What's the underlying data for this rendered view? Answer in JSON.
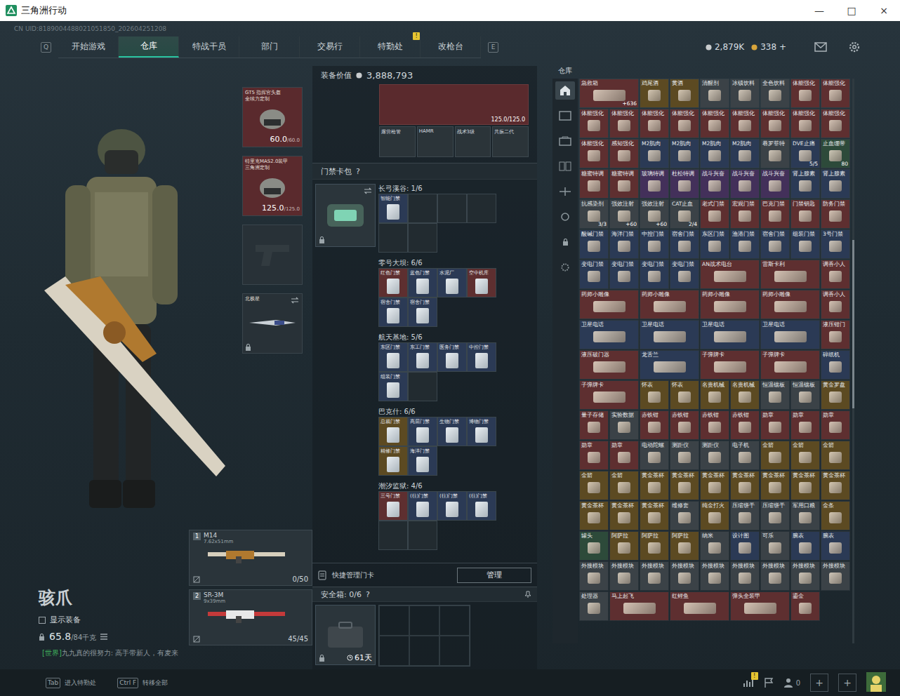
{
  "window": {
    "title": "三角洲行动",
    "controls": [
      "—",
      "□",
      "×"
    ]
  },
  "uid": "CN UID:8189004488021051850_202604251208",
  "nav": {
    "left_key": "Q",
    "right_key": "E",
    "tabs": [
      {
        "label": "开始游戏",
        "selected": false
      },
      {
        "label": "仓库",
        "selected": true
      },
      {
        "label": "特战干员",
        "selected": false
      },
      {
        "label": "部门",
        "selected": false
      },
      {
        "label": "交易行",
        "selected": false
      },
      {
        "label": "特勤处",
        "selected": false,
        "badge": "!"
      },
      {
        "label": "改枪台",
        "selected": false
      }
    ],
    "currency": [
      {
        "value": "2,879K",
        "color": "#c9ccce"
      },
      {
        "value": "338 +",
        "color": "#d9a53b"
      }
    ]
  },
  "equipment": [
    {
      "kind": "gear",
      "name": "GT5 指挥官头盔",
      "subtitle": "全续力定制",
      "durability": "60.0",
      "max": "/60.0"
    },
    {
      "kind": "gear",
      "name": "特里克MAS2.0装甲",
      "subtitle": "三角洲定制",
      "durability": "125.0",
      "max": "/125.0"
    },
    {
      "kind": "empty"
    },
    {
      "kind": "melee",
      "name": "北极星"
    }
  ],
  "character": {
    "name": "骇爪",
    "show_equipment": {
      "label": "显示装备",
      "checked": false
    },
    "weight": {
      "current": "65.8",
      "max": "/84千克"
    }
  },
  "weapons": [
    {
      "slot": "1",
      "name": "M14",
      "ammo_type": "7.62x51mm",
      "ammo": "0/50"
    },
    {
      "slot": "2",
      "name": "SR-3M",
      "ammo_type": "9x39mm",
      "ammo": "45/45"
    }
  ],
  "chat": {
    "channel": "[世界]",
    "user": "九九真的很努力",
    "message": ": 高手带新人，有麦来"
  },
  "hints": [
    {
      "key": "Tab",
      "label": "进入特勤处"
    },
    {
      "key": "Ctrl F",
      "label": "转移全部"
    }
  ],
  "loadout": {
    "label": "装备价值",
    "value": "3,888,793",
    "rig_durability": "125.0/125.0",
    "items": [
      "露营枪管",
      "HAMR",
      "战术3级",
      "共振二代"
    ]
  },
  "keycards": {
    "title": "门禁卡包",
    "help": "?",
    "maps": [
      {
        "name": "长弓溪谷: 1/6",
        "cards": [
          {
            "name": "智能门禁",
            "color": "#2b3a55"
          }
        ]
      },
      {
        "name": "零号大坝: 6/6",
        "cards": [
          {
            "name": "红色门禁",
            "color": "#5e2f30"
          },
          {
            "name": "蓝色门禁",
            "color": "#2b3a55"
          },
          {
            "name": "水泥厂",
            "color": "#2b3a55"
          },
          {
            "name": "空中机库",
            "color": "#5e2f30"
          },
          {
            "name": "宿舍门禁",
            "color": "#2b3a55"
          },
          {
            "name": "宿舍门禁",
            "color": "#2b3a55"
          }
        ]
      },
      {
        "name": "航天基地: 5/6",
        "cards": [
          {
            "name": "东区门禁",
            "color": "#2b3a55"
          },
          {
            "name": "东工门禁",
            "color": "#2b3a55"
          },
          {
            "name": "医务门禁",
            "color": "#2b3a55"
          },
          {
            "name": "中控门禁",
            "color": "#2b3a55"
          },
          {
            "name": "组装门禁",
            "color": "#2b3a55"
          }
        ]
      },
      {
        "name": "巴克什: 6/6",
        "cards": [
          {
            "name": "总裁门禁",
            "color": "#5c4a22"
          },
          {
            "name": "高层门禁",
            "color": "#2b3a55"
          },
          {
            "name": "生物门禁",
            "color": "#2b3a55"
          },
          {
            "name": "博物门禁",
            "color": "#2b3a55"
          },
          {
            "name": "精修门禁",
            "color": "#5c4a22"
          },
          {
            "name": "海洋门禁",
            "color": "#2b3a55"
          }
        ]
      },
      {
        "name": "潮汐监狱: 4/6",
        "cards": [
          {
            "name": "三号门禁",
            "color": "#5e2f30"
          },
          {
            "name": "(往)门禁",
            "color": "#2b3a55"
          },
          {
            "name": "(往)门禁",
            "color": "#2b3a55"
          },
          {
            "name": "(往)门禁",
            "color": "#2b3a55"
          }
        ]
      }
    ]
  },
  "quick_manage": {
    "label": "快捷管理门卡",
    "button": "管理"
  },
  "safe": {
    "title": "安全箱: 0/6",
    "help": "?",
    "time": "61天"
  },
  "stash": {
    "title": "仓库",
    "rail": [
      {
        "selected": true
      },
      {
        "selected": false
      },
      {
        "selected": false
      },
      {
        "selected": false
      },
      {
        "selected": false
      },
      {
        "selected": false
      },
      {
        "selected": false
      },
      {
        "selected": false
      }
    ],
    "items": [
      {
        "name": "急救箱",
        "color": "#5e2f30",
        "count": "+636",
        "kind": "wide"
      },
      {
        "name": "鸡尾酒",
        "color": "#5c4a22",
        "kind": "single"
      },
      {
        "name": "黄酒",
        "color": "#5c4a22",
        "kind": "single"
      },
      {
        "name": "清醒剂",
        "color": "#3b4247",
        "kind": "single"
      },
      {
        "name": "冰镇饮料",
        "color": "#3b4247",
        "kind": "single"
      },
      {
        "name": "全色饮料",
        "color": "#3b4247",
        "kind": "single"
      },
      {
        "name": "体能强化",
        "color": "#5e2f30",
        "kind": "single"
      },
      {
        "name": "体能强化",
        "color": "#5e2f30",
        "kind": "single"
      },
      {
        "name": "体能强化",
        "color": "#5e2f30",
        "kind": "single"
      },
      {
        "name": "体能强化",
        "color": "#5e2f30",
        "kind": "single"
      },
      {
        "name": "体能强化",
        "color": "#5e2f30",
        "kind": "single"
      },
      {
        "name": "体能强化",
        "color": "#5e2f30",
        "kind": "single"
      },
      {
        "name": "体能强化",
        "color": "#5e2f30",
        "kind": "single"
      },
      {
        "name": "体能强化",
        "color": "#5e2f30",
        "kind": "single"
      },
      {
        "name": "体能强化",
        "color": "#5e2f30",
        "kind": "single"
      },
      {
        "name": "体能强化",
        "color": "#5e2f30",
        "kind": "single"
      },
      {
        "name": "体能强化",
        "color": "#5e2f30",
        "kind": "single"
      },
      {
        "name": "体能强化",
        "color": "#5e2f30",
        "kind": "single"
      },
      {
        "name": "感知强化",
        "color": "#5e2f30",
        "kind": "single"
      },
      {
        "name": "M2肌肉",
        "color": "#2b3a55",
        "kind": "single"
      },
      {
        "name": "M2肌肉",
        "color": "#2b3a55",
        "kind": "single"
      },
      {
        "name": "M2肌肉",
        "color": "#2b3a55",
        "kind": "single"
      },
      {
        "name": "M2肌肉",
        "color": "#2b3a55",
        "kind": "single"
      },
      {
        "name": "巷罗菲特",
        "color": "#3b4247",
        "kind": "single"
      },
      {
        "name": "DVE止痛",
        "color": "#2b3a55",
        "count": "5/5",
        "kind": "single"
      },
      {
        "name": "止血绷带",
        "color": "#2d4a3a",
        "count": "80",
        "kind": "single"
      },
      {
        "name": "糖蜜特调",
        "color": "#5e2f30",
        "kind": "single"
      },
      {
        "name": "糖蜜特调",
        "color": "#5e2f30",
        "kind": "single"
      },
      {
        "name": "玻璃特调",
        "color": "#43305a",
        "kind": "single"
      },
      {
        "name": "杜松特调",
        "color": "#43305a",
        "kind": "single"
      },
      {
        "name": "战斗兴奋",
        "color": "#43305a",
        "kind": "single"
      },
      {
        "name": "战斗兴奋",
        "color": "#43305a",
        "kind": "single"
      },
      {
        "name": "战斗兴奋",
        "color": "#43305a",
        "kind": "single"
      },
      {
        "name": "肾上腺素",
        "color": "#2b3a55",
        "kind": "single"
      },
      {
        "name": "肾上腺素",
        "color": "#2b3a55",
        "kind": "single"
      },
      {
        "name": "抗感染剂",
        "color": "#3b4247",
        "count": "3/3",
        "kind": "single"
      },
      {
        "name": "强效注射",
        "color": "#3b4247",
        "count": "+60",
        "kind": "single"
      },
      {
        "name": "强效注射",
        "color": "#3b4247",
        "count": "+60",
        "kind": "single"
      },
      {
        "name": "CAT止血",
        "color": "#3b4247",
        "count": "2/4",
        "kind": "single"
      },
      {
        "name": "老式门禁",
        "color": "#5e2f30",
        "kind": "single"
      },
      {
        "name": "宏观门禁",
        "color": "#5e2f30",
        "kind": "single"
      },
      {
        "name": "巴克门禁",
        "color": "#5e2f30",
        "kind": "single"
      },
      {
        "name": "门禁钥匙",
        "color": "#5e2f30",
        "kind": "single"
      },
      {
        "name": "防务门禁",
        "color": "#5e2f30",
        "kind": "single"
      },
      {
        "name": "酸碱门禁",
        "color": "#2b3a55",
        "kind": "single"
      },
      {
        "name": "海洋门禁",
        "color": "#2b3a55",
        "kind": "single"
      },
      {
        "name": "中控门禁",
        "color": "#2b3a55",
        "kind": "single"
      },
      {
        "name": "宿舍门禁",
        "color": "#2b3a55",
        "kind": "single"
      },
      {
        "name": "东区门禁",
        "color": "#2b3a55",
        "kind": "single"
      },
      {
        "name": "渔港门禁",
        "color": "#2b3a55",
        "kind": "single"
      },
      {
        "name": "宿舍门禁",
        "color": "#2b3a55",
        "kind": "single"
      },
      {
        "name": "组装门禁",
        "color": "#2b3a55",
        "kind": "single"
      },
      {
        "name": "3号门禁",
        "color": "#2b3a55",
        "kind": "single"
      },
      {
        "name": "变电门禁",
        "color": "#2b3a55",
        "kind": "single"
      },
      {
        "name": "变电门禁",
        "color": "#2b3a55",
        "kind": "single"
      },
      {
        "name": "变电门禁",
        "color": "#2b3a55",
        "kind": "single"
      },
      {
        "name": "变电门禁",
        "color": "#2b3a55",
        "kind": "single"
      },
      {
        "name": "AN战术电台",
        "color": "#5e2f30",
        "kind": "wide"
      },
      {
        "name": "雷斯卡利",
        "color": "#5e2f30",
        "kind": "wide"
      },
      {
        "name": "调香小人",
        "color": "#5e2f30",
        "kind": "single"
      },
      {
        "name": "药师小雕像",
        "color": "#5e2f30",
        "kind": "wide"
      },
      {
        "name": "药师小雕像",
        "color": "#5e2f30",
        "kind": "wide"
      },
      {
        "name": "药师小雕像",
        "color": "#5e2f30",
        "kind": "wide"
      },
      {
        "name": "药师小雕像",
        "color": "#5e2f30",
        "kind": "wide"
      },
      {
        "name": "调香小人",
        "color": "#5e2f30",
        "kind": "single"
      },
      {
        "name": "卫星电话",
        "color": "#2b3a55",
        "kind": "wide"
      },
      {
        "name": "卫星电话",
        "color": "#2b3a55",
        "kind": "wide"
      },
      {
        "name": "卫星电话",
        "color": "#2b3a55",
        "kind": "wide"
      },
      {
        "name": "卫星电话",
        "color": "#2b3a55",
        "kind": "wide"
      },
      {
        "name": "液压钳门",
        "color": "#5e2f30",
        "kind": "single"
      },
      {
        "name": "液压破门器",
        "color": "#5e2f30",
        "kind": "wide"
      },
      {
        "name": "龙舌兰",
        "color": "#2b3a55",
        "kind": "wide"
      },
      {
        "name": "子弹牌卡",
        "color": "#5e2f30",
        "kind": "wide"
      },
      {
        "name": "子弹牌卡",
        "color": "#5e2f30",
        "kind": "wide"
      },
      {
        "name": "碎纸机",
        "color": "#2b3a55",
        "kind": "single"
      },
      {
        "name": "子弹牌卡",
        "color": "#5e2f30",
        "kind": "wide"
      },
      {
        "name": "怀表",
        "color": "#5c4a22",
        "kind": "single"
      },
      {
        "name": "怀表",
        "color": "#5c4a22",
        "kind": "single"
      },
      {
        "name": "名贵机械",
        "color": "#5c4a22",
        "kind": "single"
      },
      {
        "name": "名贵机械",
        "color": "#5c4a22",
        "kind": "single"
      },
      {
        "name": "恒温镶板",
        "color": "#3b4247",
        "kind": "single"
      },
      {
        "name": "恒温镶板",
        "color": "#3b4247",
        "kind": "single"
      },
      {
        "name": "黄金罗盘",
        "color": "#5c4a22",
        "kind": "single"
      },
      {
        "name": "量子存储",
        "color": "#5e2f30",
        "kind": "single"
      },
      {
        "name": "实验数据",
        "color": "#3b4247",
        "kind": "single"
      },
      {
        "name": "赤铁钳",
        "color": "#5e2f30",
        "kind": "single"
      },
      {
        "name": "赤铁钳",
        "color": "#5e2f30",
        "kind": "single"
      },
      {
        "name": "赤铁钳",
        "color": "#5e2f30",
        "kind": "single"
      },
      {
        "name": "赤铁钳",
        "color": "#5e2f30",
        "kind": "single"
      },
      {
        "name": "勋章",
        "color": "#5e2f30",
        "kind": "single"
      },
      {
        "name": "勋章",
        "color": "#5e2f30",
        "kind": "single"
      },
      {
        "name": "勋章",
        "color": "#5e2f30",
        "kind": "single"
      },
      {
        "name": "勋章",
        "color": "#5e2f30",
        "kind": "single"
      },
      {
        "name": "勋章",
        "color": "#5e2f30",
        "kind": "single"
      },
      {
        "name": "电动陀螺",
        "color": "#3b4247",
        "kind": "single"
      },
      {
        "name": "测距仪",
        "color": "#3b4247",
        "kind": "single"
      },
      {
        "name": "测距仪",
        "color": "#3b4247",
        "kind": "single"
      },
      {
        "name": "电子机",
        "color": "#3b4247",
        "kind": "single"
      },
      {
        "name": "金箭",
        "color": "#5c4a22",
        "kind": "single"
      },
      {
        "name": "金箭",
        "color": "#5c4a22",
        "kind": "single"
      },
      {
        "name": "金箭",
        "color": "#5c4a22",
        "kind": "single"
      },
      {
        "name": "金箭",
        "color": "#5c4a22",
        "kind": "single"
      },
      {
        "name": "金箭",
        "color": "#5c4a22",
        "kind": "single"
      },
      {
        "name": "黄金茶杯",
        "color": "#5c4a22",
        "kind": "single"
      },
      {
        "name": "黄金茶杯",
        "color": "#5c4a22",
        "kind": "single"
      },
      {
        "name": "黄金茶杯",
        "color": "#5c4a22",
        "kind": "single"
      },
      {
        "name": "黄金茶杯",
        "color": "#5c4a22",
        "kind": "single"
      },
      {
        "name": "黄金茶杯",
        "color": "#5c4a22",
        "kind": "single"
      },
      {
        "name": "黄金茶杯",
        "color": "#5c4a22",
        "kind": "single"
      },
      {
        "name": "黄金茶杯",
        "color": "#5c4a22",
        "kind": "single"
      },
      {
        "name": "黄金茶杯",
        "color": "#5c4a22",
        "kind": "single"
      },
      {
        "name": "黄金茶杯",
        "color": "#5c4a22",
        "kind": "single"
      },
      {
        "name": "黄金茶杯",
        "color": "#5c4a22",
        "kind": "single"
      },
      {
        "name": "维修套",
        "color": "#3b4247",
        "kind": "single"
      },
      {
        "name": "纯金打火",
        "color": "#5c4a22",
        "kind": "single"
      },
      {
        "name": "压缩饼干",
        "color": "#3b4247",
        "kind": "single"
      },
      {
        "name": "压缩饼干",
        "color": "#3b4247",
        "kind": "single"
      },
      {
        "name": "军用口粮",
        "color": "#3b4247",
        "kind": "single"
      },
      {
        "name": "金条",
        "color": "#5c4a22",
        "kind": "single"
      },
      {
        "name": "罐头",
        "color": "#2d4a3a",
        "kind": "single"
      },
      {
        "name": "阿萨拉",
        "color": "#5c4a22",
        "kind": "single"
      },
      {
        "name": "阿萨拉",
        "color": "#5c4a22",
        "kind": "single"
      },
      {
        "name": "阿萨拉",
        "color": "#5c4a22",
        "kind": "single"
      },
      {
        "name": "纳米",
        "color": "#3b4247",
        "kind": "single"
      },
      {
        "name": "设计图",
        "color": "#2b3a55",
        "kind": "single"
      },
      {
        "name": "可乐",
        "color": "#3b4247",
        "kind": "single"
      },
      {
        "name": "腕表",
        "color": "#2b3a55",
        "kind": "single"
      },
      {
        "name": "腕表",
        "color": "#2b3a55",
        "kind": "single"
      },
      {
        "name": "外接模块",
        "color": "#3b4247",
        "kind": "single"
      },
      {
        "name": "外接模块",
        "color": "#3b4247",
        "kind": "single"
      },
      {
        "name": "外接模块",
        "color": "#3b4247",
        "kind": "single"
      },
      {
        "name": "外接模块",
        "color": "#3b4247",
        "kind": "single"
      },
      {
        "name": "外接模块",
        "color": "#3b4247",
        "kind": "single"
      },
      {
        "name": "外接模块",
        "color": "#3b4247",
        "kind": "single"
      },
      {
        "name": "外接模块",
        "color": "#3b4247",
        "kind": "single"
      },
      {
        "name": "外接模块",
        "color": "#3b4247",
        "kind": "single"
      },
      {
        "name": "外接模块",
        "color": "#3b4247",
        "kind": "single"
      },
      {
        "name": "处理器",
        "color": "#3b4247",
        "kind": "single"
      },
      {
        "name": "马上起飞",
        "color": "#5e2f30",
        "kind": "wide"
      },
      {
        "name": "红鲤鱼",
        "color": "#5e2f30",
        "kind": "wide"
      },
      {
        "name": "弹头全装甲",
        "color": "#5e2f30",
        "kind": "wide"
      },
      {
        "name": "鎏金",
        "color": "#5e2f30",
        "kind": "single"
      }
    ]
  },
  "footer": {
    "friends": "0",
    "alert": "!",
    "add": [
      "+",
      "+"
    ]
  }
}
